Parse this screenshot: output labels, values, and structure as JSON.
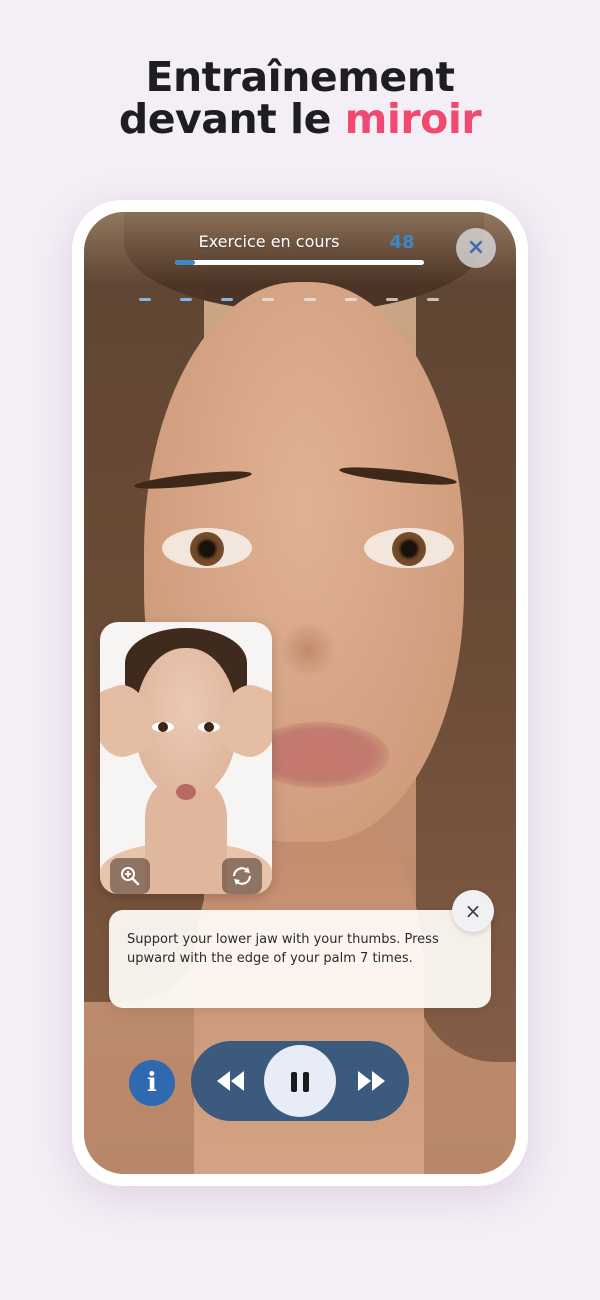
{
  "headline": {
    "line1": "Entraînement",
    "line2_prefix": "devant le ",
    "line2_accent": "miroir"
  },
  "exercise": {
    "title": "Exercice en cours",
    "count": "48",
    "progress_fraction": 0.08,
    "steps_total": 8,
    "steps_completed": 3
  },
  "instruction": {
    "text": "Support your lower jaw with your thumbs. Press upward with the edge of your palm 7 times."
  },
  "colors": {
    "accent": "#f04a71",
    "primary_blue": "#3f86c7",
    "player_bg": "#3b5a7e",
    "info_btn": "#2f6ab0"
  },
  "icons": {
    "close": "×",
    "info": "i",
    "zoom": "zoom-in-icon",
    "switch_camera": "rotate-camera-icon",
    "rewind": "rewind-icon",
    "pause": "pause-icon",
    "fast_forward": "fast-forward-icon"
  }
}
